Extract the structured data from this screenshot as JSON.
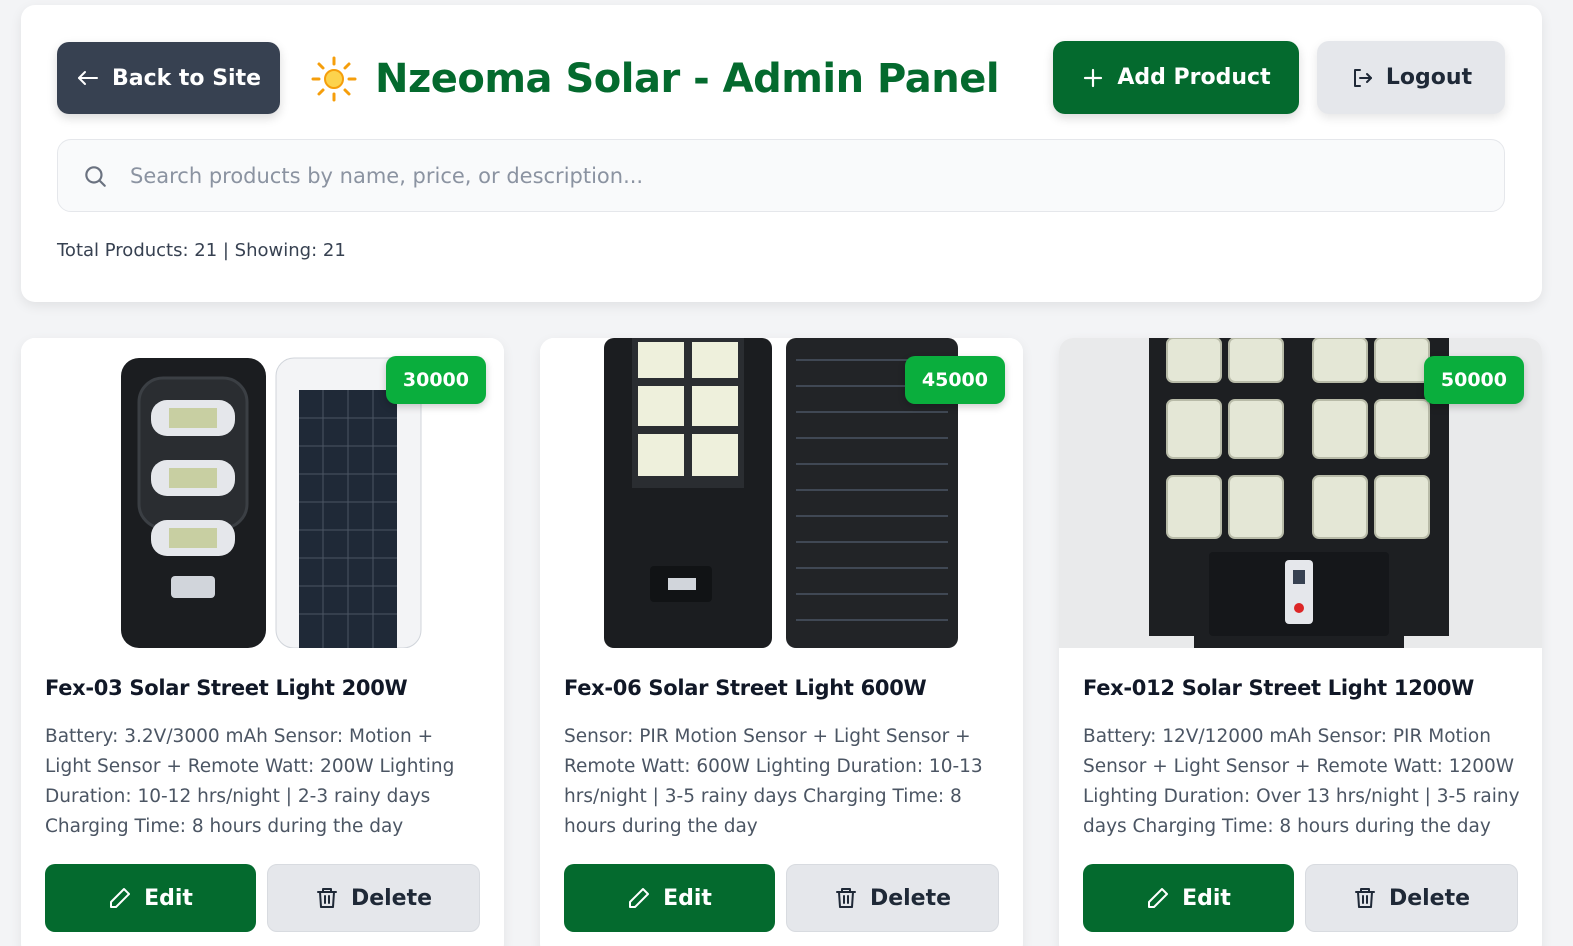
{
  "header": {
    "back_label": "Back to Site",
    "title": "Nzeoma Solar - Admin Panel",
    "add_label": "Add Product",
    "logout_label": "Logout"
  },
  "search": {
    "placeholder": "Search products by name, price, or description...",
    "value": ""
  },
  "stats": {
    "text": "Total Products: 21 | Showing: 21"
  },
  "products": [
    {
      "price": "30000",
      "name": "Fex-03 Solar Street Light 200W",
      "description": "Battery: 3.2V/3000 mAh Sensor: Motion + Light Sensor + Remote Watt: 200W Lighting Duration: 10-12 hrs/night | 2-3 rainy days Charging Time: 8 hours during the day",
      "edit_label": "Edit",
      "delete_label": "Delete"
    },
    {
      "price": "45000",
      "name": "Fex-06 Solar Street Light 600W",
      "description": "Sensor: PIR Motion Sensor + Light Sensor + Remote Watt: 600W Lighting Duration: 10-13 hrs/night | 3-5 rainy days Charging Time: 8 hours during the day",
      "edit_label": "Edit",
      "delete_label": "Delete"
    },
    {
      "price": "50000",
      "name": "Fex-012 Solar Street Light 1200W",
      "description": "Battery: 12V/12000 mAh Sensor: PIR Motion Sensor + Light Sensor + Remote Watt: 1200W Lighting Duration: Over 13 hrs/night | 3-5 rainy days Charging Time: 8 hours during the day",
      "edit_label": "Edit",
      "delete_label": "Delete"
    }
  ],
  "colors": {
    "brand_green": "#046a2e",
    "badge_green": "#0aae3d",
    "back_button": "#374151",
    "page_bg": "#f3f4f6"
  },
  "icons": {
    "back": "arrow-left-icon",
    "title": "sun-icon",
    "add": "plus-icon",
    "logout": "logout-icon",
    "search": "search-icon",
    "edit": "pencil-icon",
    "delete": "trash-icon"
  }
}
